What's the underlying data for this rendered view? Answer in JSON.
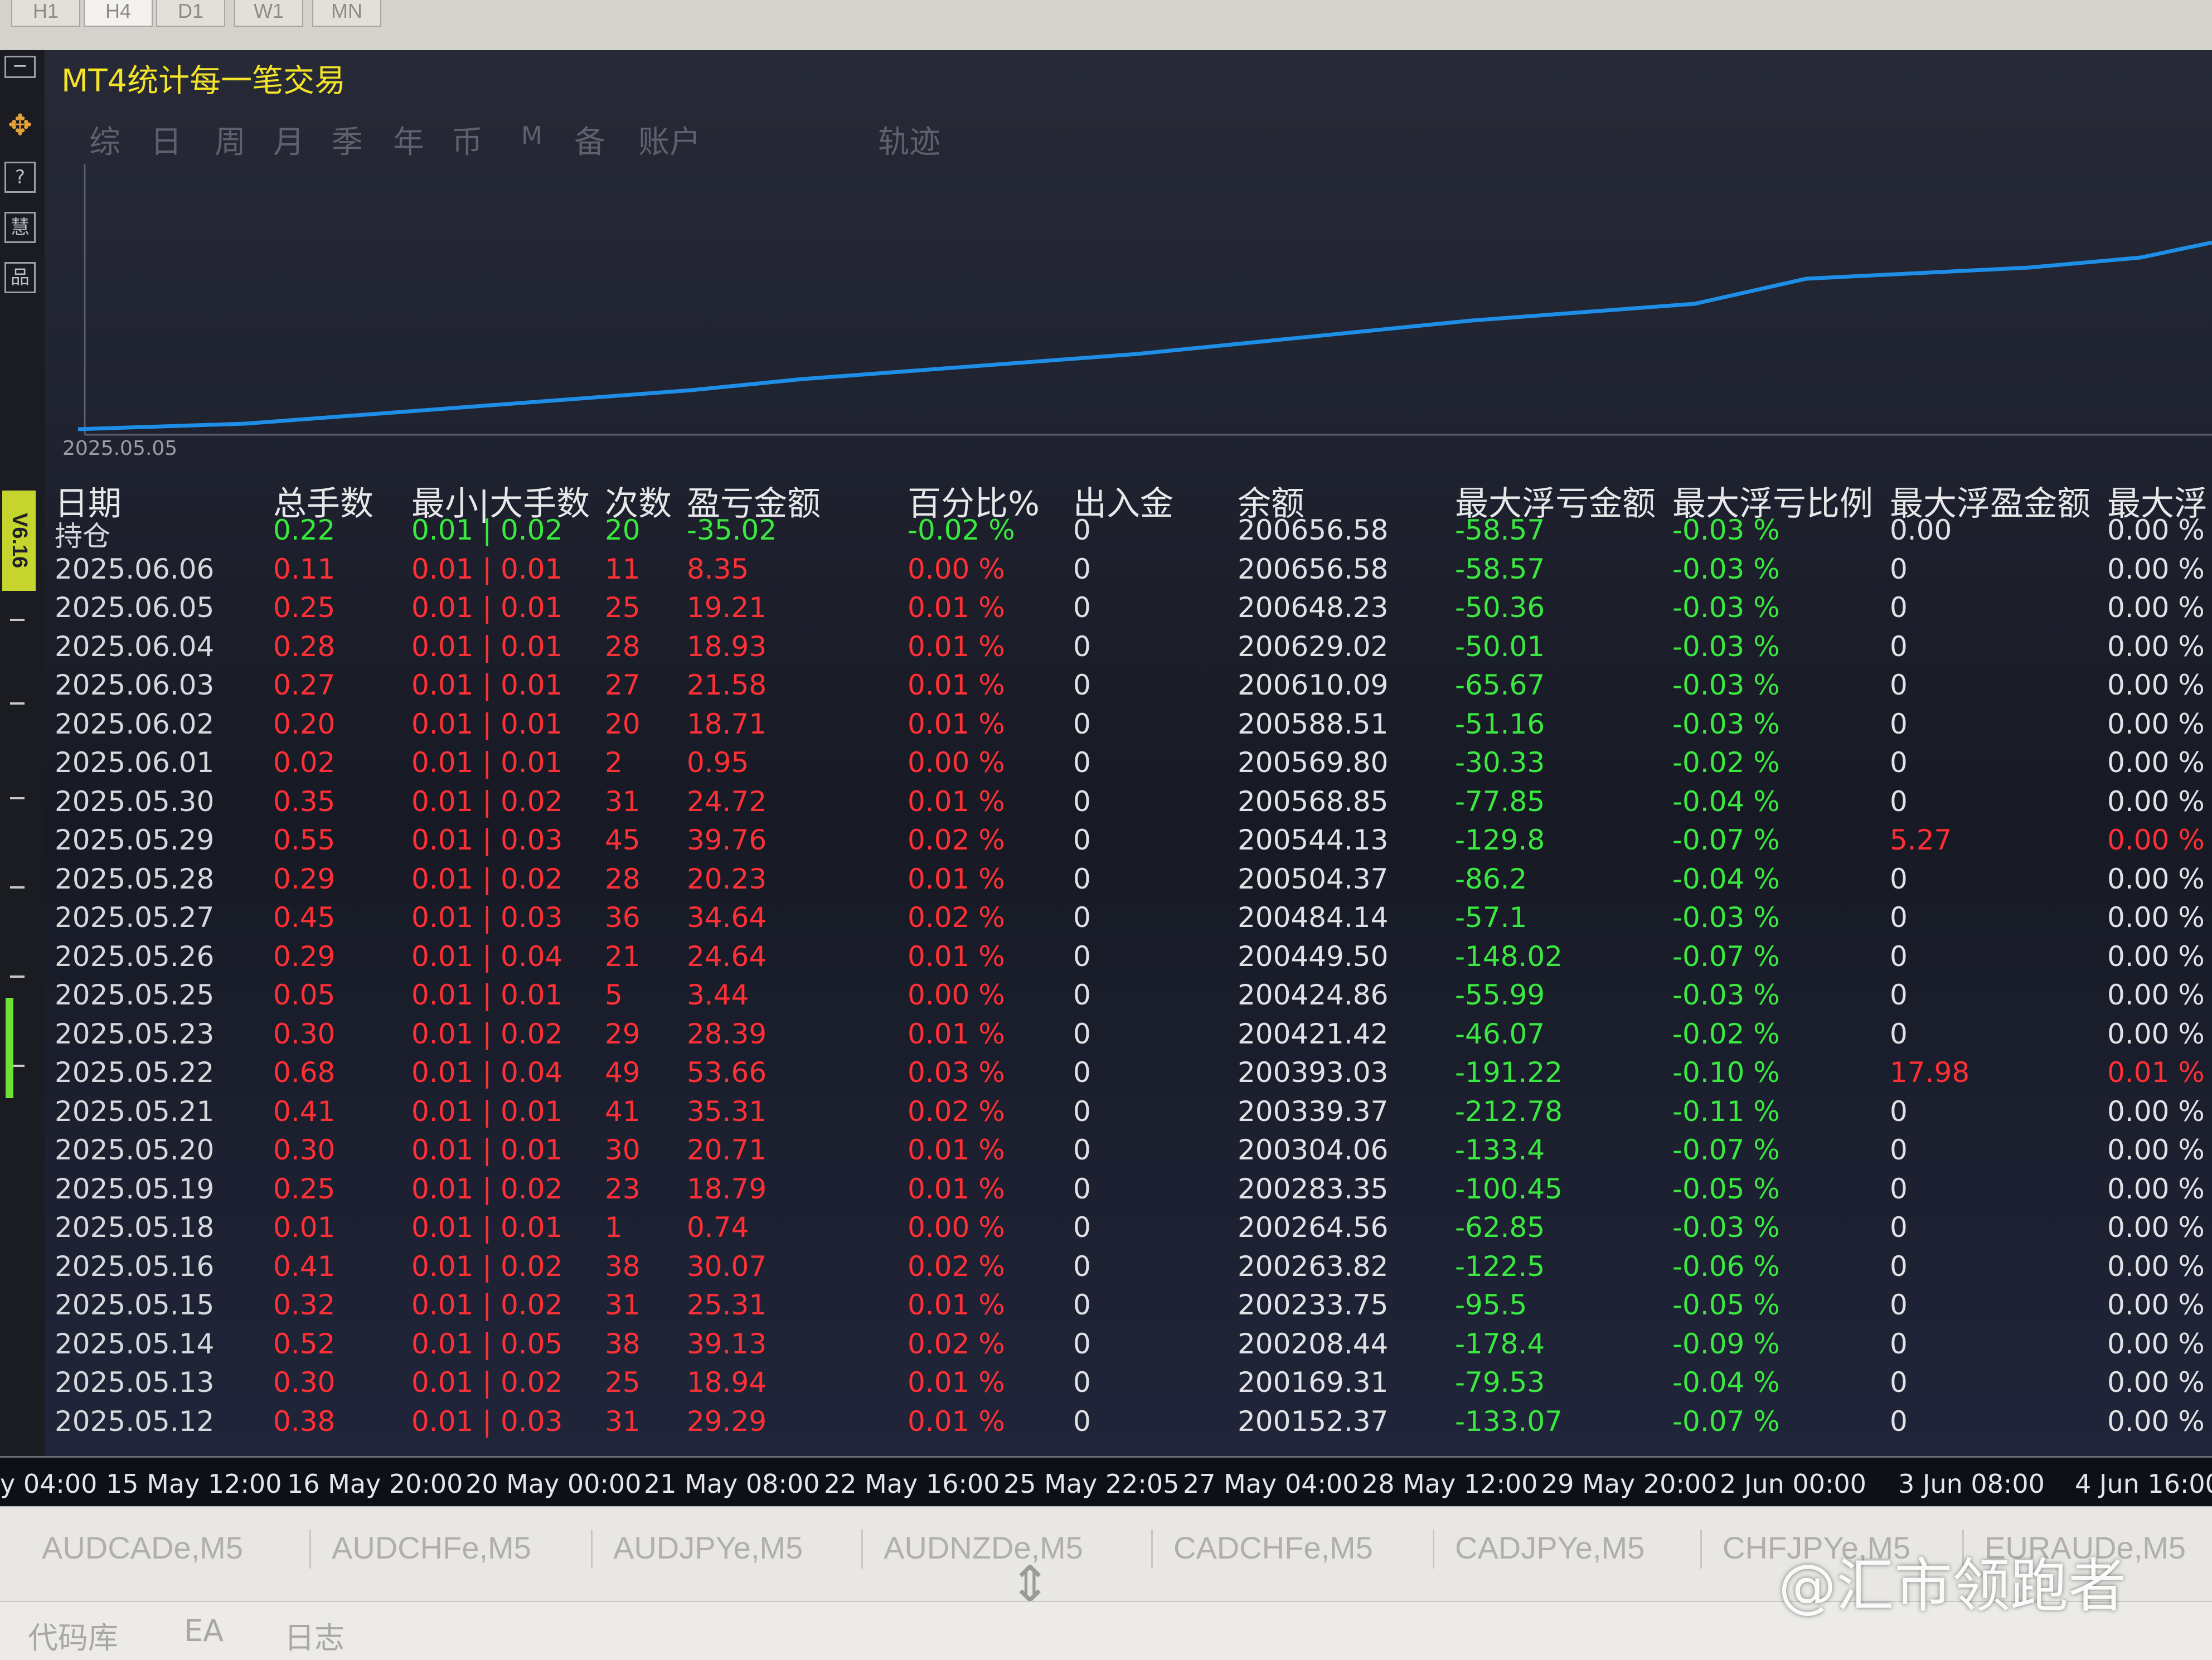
{
  "timeframes": [
    "H1",
    "H4",
    "D1",
    "W1",
    "MN"
  ],
  "timeframe_active": "H4",
  "left_tools": [
    "?",
    "慧",
    "品"
  ],
  "version": "V6.16",
  "ea": {
    "title": "MT4统计每一笔交易",
    "tabs": [
      "综",
      "日",
      "周",
      "月",
      "季",
      "年",
      "币",
      "M",
      "备",
      "账户",
      "轨迹"
    ]
  },
  "equity_chart": {
    "start_label": "2025.05.05",
    "line_color": "#1e8fe8",
    "trend": "steadily rising",
    "grid": false
  },
  "table": {
    "headers": [
      "日期",
      "总手数",
      "最小|大手数",
      "次数",
      "盈亏金额",
      "百分比%",
      "出入金",
      "余额",
      "最大浮亏金额",
      "最大浮亏比例",
      "最大浮盈金额",
      "最大浮"
    ],
    "holding": {
      "date": "持仓",
      "lots": "0.22",
      "minmax": "0.01 | 0.02",
      "count": "20",
      "pnl": "-35.02",
      "pct": "-0.02 %",
      "deposit": "0",
      "balance": "200656.58",
      "dd_amt": "-58.57",
      "dd_pct": "-0.03 %",
      "fp_amt": "0.00",
      "fp_pct": "0.00 %"
    },
    "rows": [
      {
        "date": "2025.06.06",
        "lots": "0.11",
        "minmax": "0.01 | 0.01",
        "count": "11",
        "pnl": "8.35",
        "pct": "0.00 %",
        "deposit": "0",
        "balance": "200656.58",
        "dd_amt": "-58.57",
        "dd_pct": "-0.03 %",
        "fp_amt": "0",
        "fp_pct": "0.00 %"
      },
      {
        "date": "2025.06.05",
        "lots": "0.25",
        "minmax": "0.01 | 0.01",
        "count": "25",
        "pnl": "19.21",
        "pct": "0.01 %",
        "deposit": "0",
        "balance": "200648.23",
        "dd_amt": "-50.36",
        "dd_pct": "-0.03 %",
        "fp_amt": "0",
        "fp_pct": "0.00 %"
      },
      {
        "date": "2025.06.04",
        "lots": "0.28",
        "minmax": "0.01 | 0.01",
        "count": "28",
        "pnl": "18.93",
        "pct": "0.01 %",
        "deposit": "0",
        "balance": "200629.02",
        "dd_amt": "-50.01",
        "dd_pct": "-0.03 %",
        "fp_amt": "0",
        "fp_pct": "0.00 %"
      },
      {
        "date": "2025.06.03",
        "lots": "0.27",
        "minmax": "0.01 | 0.01",
        "count": "27",
        "pnl": "21.58",
        "pct": "0.01 %",
        "deposit": "0",
        "balance": "200610.09",
        "dd_amt": "-65.67",
        "dd_pct": "-0.03 %",
        "fp_amt": "0",
        "fp_pct": "0.00 %"
      },
      {
        "date": "2025.06.02",
        "lots": "0.20",
        "minmax": "0.01 | 0.01",
        "count": "20",
        "pnl": "18.71",
        "pct": "0.01 %",
        "deposit": "0",
        "balance": "200588.51",
        "dd_amt": "-51.16",
        "dd_pct": "-0.03 %",
        "fp_amt": "0",
        "fp_pct": "0.00 %"
      },
      {
        "date": "2025.06.01",
        "lots": "0.02",
        "minmax": "0.01 | 0.01",
        "count": "2",
        "pnl": "0.95",
        "pct": "0.00 %",
        "deposit": "0",
        "balance": "200569.80",
        "dd_amt": "-30.33",
        "dd_pct": "-0.02 %",
        "fp_amt": "0",
        "fp_pct": "0.00 %"
      },
      {
        "date": "2025.05.30",
        "lots": "0.35",
        "minmax": "0.01 | 0.02",
        "count": "31",
        "pnl": "24.72",
        "pct": "0.01 %",
        "deposit": "0",
        "balance": "200568.85",
        "dd_amt": "-77.85",
        "dd_pct": "-0.04 %",
        "fp_amt": "0",
        "fp_pct": "0.00 %"
      },
      {
        "date": "2025.05.29",
        "lots": "0.55",
        "minmax": "0.01 | 0.03",
        "count": "45",
        "pnl": "39.76",
        "pct": "0.02 %",
        "deposit": "0",
        "balance": "200544.13",
        "dd_amt": "-129.8",
        "dd_pct": "-0.07 %",
        "fp_amt": "5.27",
        "fp_pct": "0.00 %",
        "fp_red": true
      },
      {
        "date": "2025.05.28",
        "lots": "0.29",
        "minmax": "0.01 | 0.02",
        "count": "28",
        "pnl": "20.23",
        "pct": "0.01 %",
        "deposit": "0",
        "balance": "200504.37",
        "dd_amt": "-86.2",
        "dd_pct": "-0.04 %",
        "fp_amt": "0",
        "fp_pct": "0.00 %"
      },
      {
        "date": "2025.05.27",
        "lots": "0.45",
        "minmax": "0.01 | 0.03",
        "count": "36",
        "pnl": "34.64",
        "pct": "0.02 %",
        "deposit": "0",
        "balance": "200484.14",
        "dd_amt": "-57.1",
        "dd_pct": "-0.03 %",
        "fp_amt": "0",
        "fp_pct": "0.00 %"
      },
      {
        "date": "2025.05.26",
        "lots": "0.29",
        "minmax": "0.01 | 0.04",
        "count": "21",
        "pnl": "24.64",
        "pct": "0.01 %",
        "deposit": "0",
        "balance": "200449.50",
        "dd_amt": "-148.02",
        "dd_pct": "-0.07 %",
        "fp_amt": "0",
        "fp_pct": "0.00 %"
      },
      {
        "date": "2025.05.25",
        "lots": "0.05",
        "minmax": "0.01 | 0.01",
        "count": "5",
        "pnl": "3.44",
        "pct": "0.00 %",
        "deposit": "0",
        "balance": "200424.86",
        "dd_amt": "-55.99",
        "dd_pct": "-0.03 %",
        "fp_amt": "0",
        "fp_pct": "0.00 %"
      },
      {
        "date": "2025.05.23",
        "lots": "0.30",
        "minmax": "0.01 | 0.02",
        "count": "29",
        "pnl": "28.39",
        "pct": "0.01 %",
        "deposit": "0",
        "balance": "200421.42",
        "dd_amt": "-46.07",
        "dd_pct": "-0.02 %",
        "fp_amt": "0",
        "fp_pct": "0.00 %"
      },
      {
        "date": "2025.05.22",
        "lots": "0.68",
        "minmax": "0.01 | 0.04",
        "count": "49",
        "pnl": "53.66",
        "pct": "0.03 %",
        "deposit": "0",
        "balance": "200393.03",
        "dd_amt": "-191.22",
        "dd_pct": "-0.10 %",
        "fp_amt": "17.98",
        "fp_pct": "0.01 %",
        "fp_red": true
      },
      {
        "date": "2025.05.21",
        "lots": "0.41",
        "minmax": "0.01 | 0.01",
        "count": "41",
        "pnl": "35.31",
        "pct": "0.02 %",
        "deposit": "0",
        "balance": "200339.37",
        "dd_amt": "-212.78",
        "dd_pct": "-0.11 %",
        "fp_amt": "0",
        "fp_pct": "0.00 %"
      },
      {
        "date": "2025.05.20",
        "lots": "0.30",
        "minmax": "0.01 | 0.01",
        "count": "30",
        "pnl": "20.71",
        "pct": "0.01 %",
        "deposit": "0",
        "balance": "200304.06",
        "dd_amt": "-133.4",
        "dd_pct": "-0.07 %",
        "fp_amt": "0",
        "fp_pct": "0.00 %"
      },
      {
        "date": "2025.05.19",
        "lots": "0.25",
        "minmax": "0.01 | 0.02",
        "count": "23",
        "pnl": "18.79",
        "pct": "0.01 %",
        "deposit": "0",
        "balance": "200283.35",
        "dd_amt": "-100.45",
        "dd_pct": "-0.05 %",
        "fp_amt": "0",
        "fp_pct": "0.00 %"
      },
      {
        "date": "2025.05.18",
        "lots": "0.01",
        "minmax": "0.01 | 0.01",
        "count": "1",
        "pnl": "0.74",
        "pct": "0.00 %",
        "deposit": "0",
        "balance": "200264.56",
        "dd_amt": "-62.85",
        "dd_pct": "-0.03 %",
        "fp_amt": "0",
        "fp_pct": "0.00 %"
      },
      {
        "date": "2025.05.16",
        "lots": "0.41",
        "minmax": "0.01 | 0.02",
        "count": "38",
        "pnl": "30.07",
        "pct": "0.02 %",
        "deposit": "0",
        "balance": "200263.82",
        "dd_amt": "-122.5",
        "dd_pct": "-0.06 %",
        "fp_amt": "0",
        "fp_pct": "0.00 %"
      },
      {
        "date": "2025.05.15",
        "lots": "0.32",
        "minmax": "0.01 | 0.02",
        "count": "31",
        "pnl": "25.31",
        "pct": "0.01 %",
        "deposit": "0",
        "balance": "200233.75",
        "dd_amt": "-95.5",
        "dd_pct": "-0.05 %",
        "fp_amt": "0",
        "fp_pct": "0.00 %"
      },
      {
        "date": "2025.05.14",
        "lots": "0.52",
        "minmax": "0.01 | 0.05",
        "count": "38",
        "pnl": "39.13",
        "pct": "0.02 %",
        "deposit": "0",
        "balance": "200208.44",
        "dd_amt": "-178.4",
        "dd_pct": "-0.09 %",
        "fp_amt": "0",
        "fp_pct": "0.00 %"
      },
      {
        "date": "2025.05.13",
        "lots": "0.30",
        "minmax": "0.01 | 0.02",
        "count": "25",
        "pnl": "18.94",
        "pct": "0.01 %",
        "deposit": "0",
        "balance": "200169.31",
        "dd_amt": "-79.53",
        "dd_pct": "-0.04 %",
        "fp_amt": "0",
        "fp_pct": "0.00 %"
      },
      {
        "date": "2025.05.12",
        "lots": "0.38",
        "minmax": "0.01 | 0.03",
        "count": "31",
        "pnl": "29.29",
        "pct": "0.01 %",
        "deposit": "0",
        "balance": "200152.37",
        "dd_amt": "-133.07",
        "dd_pct": "-0.07 %",
        "fp_amt": "0",
        "fp_pct": "0.00 %"
      }
    ]
  },
  "time_axis": [
    "y 04:00",
    "15 May 12:00",
    "16 May 20:00",
    "20 May 00:00",
    "21 May 08:00",
    "22 May 16:00",
    "25 May 22:05",
    "27 May 04:00",
    "28 May 12:00",
    "29 May 20:00",
    "2 Jun 00:00",
    "3 Jun 08:00",
    "4 Jun 16:00"
  ],
  "symbol_tabs": [
    "AUDCADe,M5",
    "AUDCHFe,M5",
    "AUDJPYe,M5",
    "AUDNZDe,M5",
    "CADCHFe,M5",
    "CADJPYe,M5",
    "CHFJPYe,M5",
    "EURAUDe,M5"
  ],
  "bottom_tabs": [
    "代码库",
    "EA",
    "日志"
  ],
  "watermark": "@汇市领跑者",
  "colors": {
    "positive": "#ff2f36",
    "negative": "#39e93f",
    "title": "#f3e329",
    "equity_line": "#1e8fe8"
  }
}
